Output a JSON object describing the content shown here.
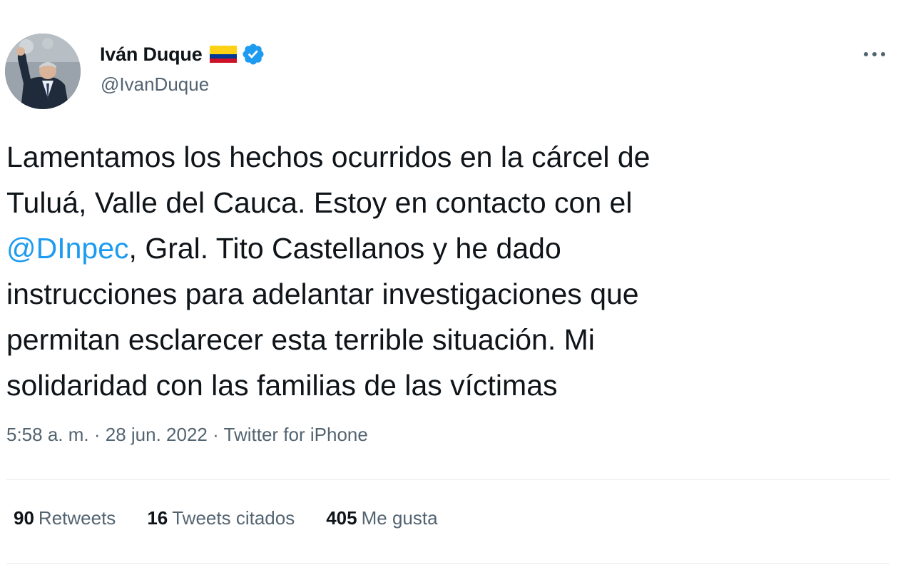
{
  "user": {
    "display_name": "Iván Duque",
    "handle": "@IvanDuque",
    "flag_icon": "colombia-flag-icon",
    "verified_icon": "verified-badge-icon",
    "avatar_icon": "profile-photo"
  },
  "more_menu_icon": "more-options-icon",
  "tweet": {
    "text_part1": "Lamentamos los hechos ocurridos en la cárcel de\nTuluá, Valle del Cauca. Estoy en contacto con el\n",
    "mention": "@DInpec",
    "text_part2": ", Gral. Tito Castellanos y he dado\ninstrucciones para adelantar investigaciones que\npermitan esclarecer esta terrible situación. Mi\nsolidaridad con las familias de las víctimas",
    "time": "5:58 a. m.",
    "separator": " · ",
    "date": "28 jun. 2022",
    "source": "Twitter for iPhone"
  },
  "stats": {
    "retweets_count": "90",
    "retweets_label": "Retweets",
    "quotes_count": "16",
    "quotes_label": "Tweets citados",
    "likes_count": "405",
    "likes_label": "Me gusta"
  },
  "colors": {
    "text": "#0f1419",
    "secondary": "#536471",
    "link": "#1d9bf0",
    "verified": "#1d9bf0",
    "flag_yellow": "#fcd116",
    "flag_blue": "#003893",
    "flag_red": "#ce1126"
  }
}
